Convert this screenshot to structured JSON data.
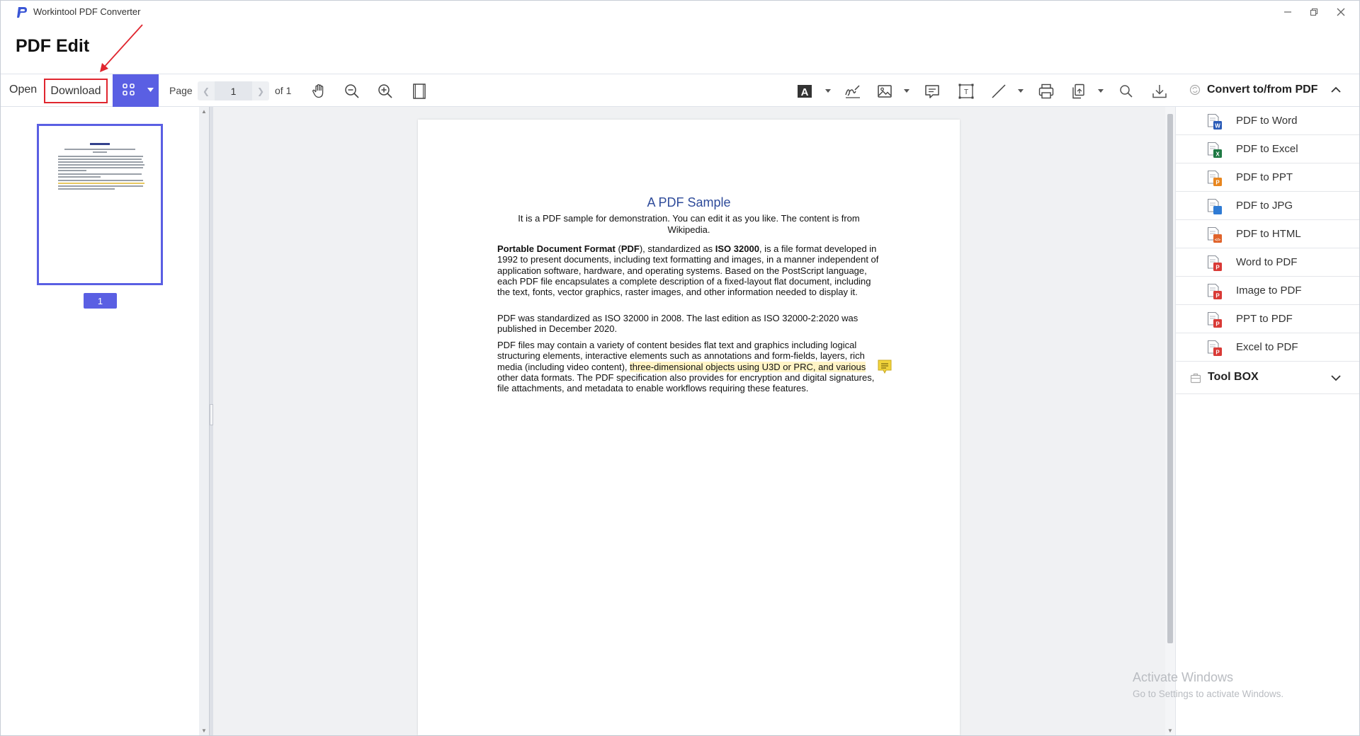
{
  "window": {
    "app_title": "Workintool PDF Converter",
    "logo_letter": "P",
    "controls": [
      "minimize-icon",
      "restore-icon",
      "close-icon"
    ]
  },
  "page_heading": "PDF Edit",
  "toolbar": {
    "open_label": "Open",
    "download_label": "Download",
    "page_label": "Page",
    "page_value": "1",
    "page_total": "of 1",
    "icons": [
      "grid-view-icon",
      "hand-icon",
      "zoom-out-icon",
      "zoom-in-icon",
      "fit-page-icon",
      "text-icon",
      "signature-icon",
      "image-icon",
      "comment-icon",
      "text-box-icon",
      "line-icon",
      "print-icon",
      "export-icon",
      "search-icon",
      "download-icon"
    ]
  },
  "convert_panel": {
    "header": "Convert to/from PDF",
    "items": [
      {
        "label": "PDF to Word",
        "icon": "word-icon",
        "color": "#2b5cb8",
        "tag": "W"
      },
      {
        "label": "PDF to Excel",
        "icon": "excel-icon",
        "color": "#1f7a44",
        "tag": "X"
      },
      {
        "label": "PDF to PPT",
        "icon": "ppt-icon",
        "color": "#e8861f",
        "tag": "P"
      },
      {
        "label": "PDF to JPG",
        "icon": "jpg-icon",
        "color": "#2f7bd4",
        "tag": ""
      },
      {
        "label": "PDF to HTML",
        "icon": "html-icon",
        "color": "#e0632b",
        "tag": "</>"
      },
      {
        "label": "Word to PDF",
        "icon": "word-to-pdf-icon",
        "color": "#d93a36",
        "tag": "P"
      },
      {
        "label": "Image to PDF",
        "icon": "image-to-pdf-icon",
        "color": "#d93a36",
        "tag": "P"
      },
      {
        "label": "PPT to PDF",
        "icon": "ppt-to-pdf-icon",
        "color": "#d93a36",
        "tag": "P"
      },
      {
        "label": "Excel to PDF",
        "icon": "excel-to-pdf-icon",
        "color": "#d93a36",
        "tag": "P"
      }
    ],
    "toolbox_label": "Tool BOX"
  },
  "thumbnail": {
    "page_number": "1"
  },
  "document": {
    "title": "A PDF Sample",
    "subtitle": "It is a PDF sample for demonstration. You can edit it as you like. The content is from Wikipedia.",
    "para1": {
      "b1": "Portable Document Format",
      "t1": " (",
      "b2": "PDF",
      "t2": "), standardized as ",
      "b3": "ISO 32000",
      "t3": ", is a file format developed in 1992 to present documents, including text formatting and images, in a manner independent of application software, hardware, and operating systems. Based on the PostScript language, each PDF file encapsulates a complete description of a fixed-layout flat document, including the text, fonts, vector graphics, raster images, and other information needed to display it."
    },
    "para2": "PDF was standardized as ISO 32000 in 2008. The last edition as ISO 32000-2:2020 was published in December 2020.",
    "para3": {
      "t1": "PDF files may contain a variety of content besides flat text and graphics including logical structuring elements, interactive elements such as annotations and form-fields, layers, rich media (including video content), ",
      "hl": "three-dimensional objects using U3D or PRC, and various",
      "t2": " other data formats. The PDF specification also provides for encryption and digital signatures, file attachments, and metadata to enable workflows requiring these features."
    }
  },
  "watermark": {
    "line1": "Activate Windows",
    "line2": "Go to Settings to activate Windows."
  },
  "colors": {
    "accent": "#5a5fe3",
    "highlight_box": "#e0262f",
    "doc_title": "#2e4b9a"
  }
}
